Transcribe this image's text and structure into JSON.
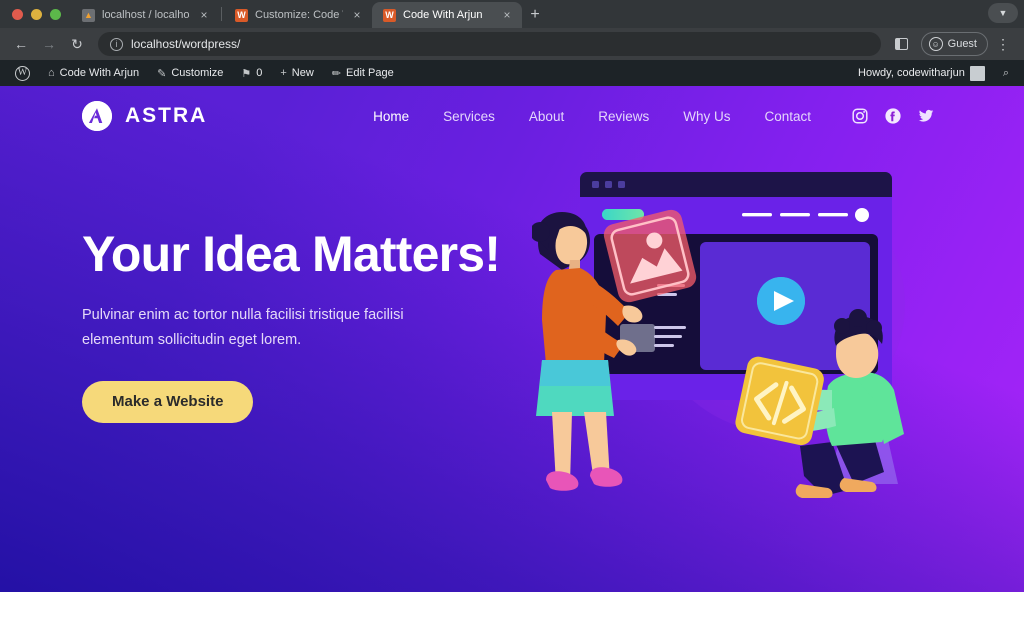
{
  "browser": {
    "tabs": [
      {
        "title": "localhost / localhost / wordpr",
        "favicon": "phpmyadmin-icon",
        "active": false,
        "close": "×"
      },
      {
        "title": "Customize: Code With Arjun",
        "favicon": "wordpress-icon",
        "active": false,
        "close": "×"
      },
      {
        "title": "Code With Arjun",
        "favicon": "wordpress-icon",
        "active": true,
        "close": "×"
      }
    ],
    "new_tab_label": "+",
    "tabstrip_chevron": "▼",
    "toolbar": {
      "back": "←",
      "forward": "→",
      "reload": "↻",
      "site_info_icon": "ⓘ",
      "url": "localhost/wordpress/",
      "side_panel_icon": "side-panel-icon",
      "profile_label": "Guest",
      "profile_icon": "☺",
      "menu": "⋮"
    }
  },
  "adminbar": {
    "wp_logo": "W",
    "site_name": "Code With Arjun",
    "site_icon": "⌂",
    "customize": "Customize",
    "customize_icon": "✎",
    "comments_icon": "⚑",
    "comments_count": "0",
    "new_icon": "+",
    "new_label": "New",
    "edit_icon": "✏",
    "edit_label": "Edit Page",
    "howdy": "Howdy, codewitharjun",
    "search_icon": "⌕"
  },
  "site": {
    "brand": {
      "name": "ASTRA",
      "mark": "astra-logo-icon"
    },
    "nav": [
      {
        "label": "Home",
        "active": true
      },
      {
        "label": "Services",
        "active": false
      },
      {
        "label": "About",
        "active": false
      },
      {
        "label": "Reviews",
        "active": false
      },
      {
        "label": "Why Us",
        "active": false
      },
      {
        "label": "Contact",
        "active": false
      }
    ],
    "socials": [
      {
        "name": "instagram-icon"
      },
      {
        "name": "facebook-icon"
      },
      {
        "name": "twitter-icon"
      }
    ],
    "hero": {
      "title": "Your Idea Matters!",
      "subtitle": "Pulvinar enim ac tortor nulla facilisi tristique facilisi elementum sollicitudin eget lorem.",
      "cta_label": "Make a Website",
      "illustration": "website-builder-illustration"
    },
    "colors": {
      "hero_gradient_start": "#5a1fd4",
      "hero_gradient_end": "#a625f7",
      "cta_background": "#f6d97a",
      "cta_text": "#2b2b2b",
      "nav_text": "#e4d6fb",
      "admin_bar": "#1d2327"
    }
  }
}
